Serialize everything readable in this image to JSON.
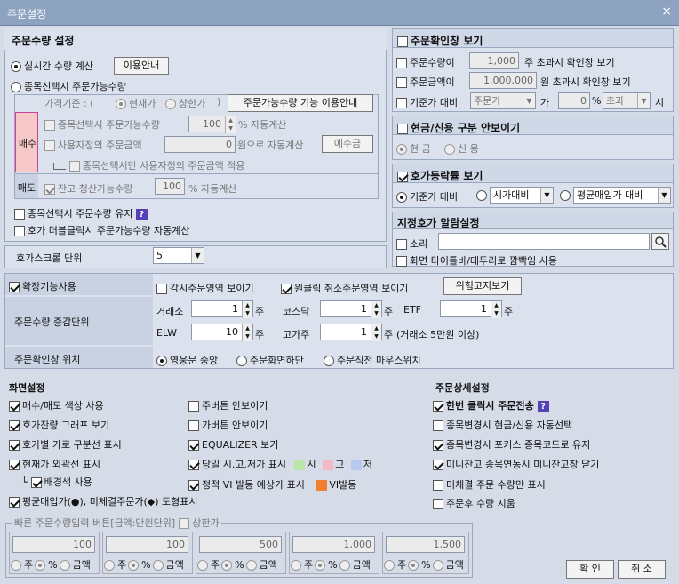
{
  "window": {
    "title": "주문설정",
    "close": "×"
  },
  "qty": {
    "title": "주문수량 설정",
    "realtime": "실시간 수량 계산",
    "guide_btn": "이용안내",
    "by_amount": "종목선택시 주문가능수량",
    "price_base": "가격기준 : (",
    "cur_price": "현재가",
    "upper_price": "상한가",
    "paren_close": ")",
    "feature_btn": "주문가능수량 기능 이용안내",
    "buy": "매수",
    "sell": "매도",
    "sel_avail": "종목선택시 주문가능수량",
    "avail_val": "100",
    "pct_auto": "% 자동계산",
    "user_amt": "사용자정의 주문금액",
    "user_val": "0",
    "won_auto": "원으로 자동계산",
    "deposit_btn": "예수금",
    "only_user": "종목선택시만 사용자정의 주문금액 적용",
    "balance": "잔고 청산가능수량",
    "balance_val": "100",
    "keep": "종목선택시 주문수량 유지",
    "help": "?",
    "dblclick": "호가 더블클릭시 주문가능수량 자동계산"
  },
  "scroll": {
    "label": "호가스크롤 단위",
    "value": "5"
  },
  "confirm": {
    "title": "주문확인창 보기",
    "qty_label": "주문수량이",
    "qty_val": "1,000",
    "qty_suffix": "주 초과시 확인창 보기",
    "amt_label": "주문금액이",
    "amt_val": "1,000,000",
    "amt_suffix": "원 초과시 확인창 보기",
    "base_label": "기준가 대비",
    "base_sel": "주문가",
    "ga": "가",
    "pct_val": "0",
    "pct": "%",
    "over_sel": "초과",
    "si": "시"
  },
  "credit": {
    "title": "현금/신용 구분 안보이기",
    "cash": "현 금",
    "credit": "신 용"
  },
  "ratio": {
    "title": "호가등락률 보기",
    "base": "기준가 대비",
    "start": "시가대비",
    "avg": "평균매입가 대비"
  },
  "alarm": {
    "title": "지정호가 알람설정",
    "sound": "소리",
    "sound_val": "",
    "flash": "화면 타이틀바/테두리로 깜빡임 사용"
  },
  "ext": {
    "label": "확장기능사용",
    "watch": "감시주문영역 보이기",
    "oneclick": "원클릭 취소주문영역 보이기",
    "risk_btn": "위험고지보기"
  },
  "step": {
    "label": "주문수량 증감단위",
    "kospi": "거래소",
    "kospi_v": "1",
    "kosdaq": "코스닥",
    "kosdaq_v": "1",
    "etf": "ETF",
    "etf_v": "1",
    "elw": "ELW",
    "elw_v": "10",
    "high": "고가주",
    "high_v": "1",
    "high_note": "(거래소 5만원 이상)",
    "unit": "주"
  },
  "pos": {
    "label": "주문확인창 위치",
    "center": "영웅문 중앙",
    "bottom": "주문화면하단",
    "cursor": "주문직전 마우스위치"
  },
  "screen": {
    "title": "화면설정",
    "c1": [
      "매수/매도 색상 사용",
      "호가잔량 그래프 보기",
      "호가별 가로 구분선 표시",
      "현재가 외곽선 표시",
      "배경색 사용",
      "평균매입가(●), 미체결주문가(◆) 도형표시"
    ],
    "c2": [
      "주버튼 안보이기",
      "가버튼 안보이기",
      "EQUALIZER 보기",
      "당일 시.고.저가 표시",
      "정적 VI 발동 예상가 표시"
    ],
    "shi": "시",
    "go": "고",
    "jeo": "저",
    "vi": "VI발동",
    "c_shi": "#b8e6a8",
    "c_go": "#f4b8c4",
    "c_jeo": "#b8c8ee",
    "c_vi": "#f08030"
  },
  "detail": {
    "title": "주문상세설정",
    "items": [
      "한번 클릭시 주문전송",
      "종목변경시 현금/신용 자동선택",
      "종목변경시 포커스 종목코드로 유지",
      "미니잔고 종목연동시 미니잔고창 닫기",
      "미체결 주문 수량만 표시",
      "주문후 수량 지움"
    ],
    "help": "?"
  },
  "quick": {
    "title": "빠른 주문수량입력 버튼[금액:만원단위]",
    "upper": "상한가",
    "vals": [
      "100",
      "100",
      "500",
      "1,000",
      "1,500"
    ],
    "ju": "주",
    "pct": "%",
    "amt": "금액"
  },
  "footer": {
    "ok": "확 인",
    "cancel": "취 소"
  }
}
